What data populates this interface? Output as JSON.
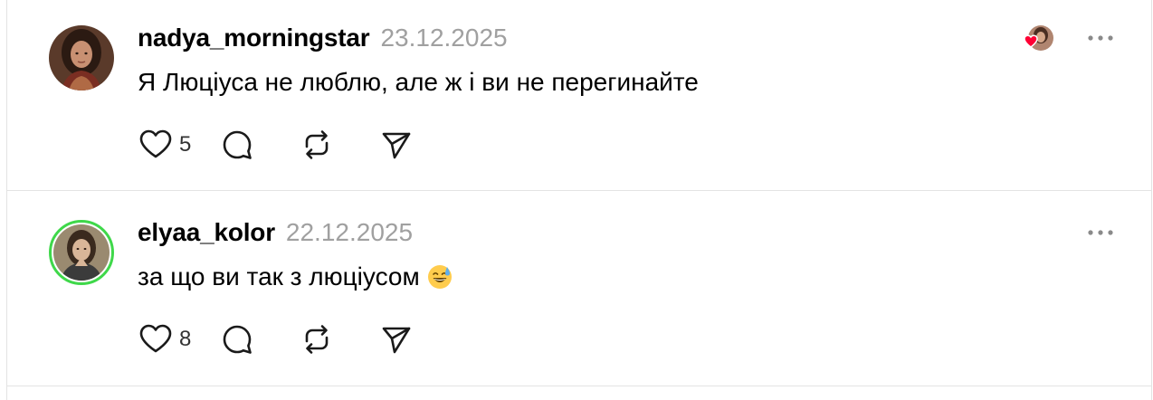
{
  "posts": [
    {
      "username": "nadya_morningstar",
      "timestamp": "23.12.2025",
      "text": "Я Люціуса не люблю, але ж і ви не перегинайте",
      "like_count": "5",
      "author_liked_indicator": true
    },
    {
      "username": "elyaa_kolor",
      "timestamp": "22.12.2025",
      "text": "за що ви так з люціусом",
      "emoji": "sweat-smile",
      "like_count": "8"
    }
  ],
  "icons": {
    "like": "heart-icon",
    "reply": "comment-icon",
    "repost": "repost-icon",
    "share": "send-icon",
    "more": "more-icon"
  },
  "colors": {
    "heart_red": "#ff0034",
    "ring_green": "#3fd84a",
    "muted_text": "#a0a0a0"
  }
}
